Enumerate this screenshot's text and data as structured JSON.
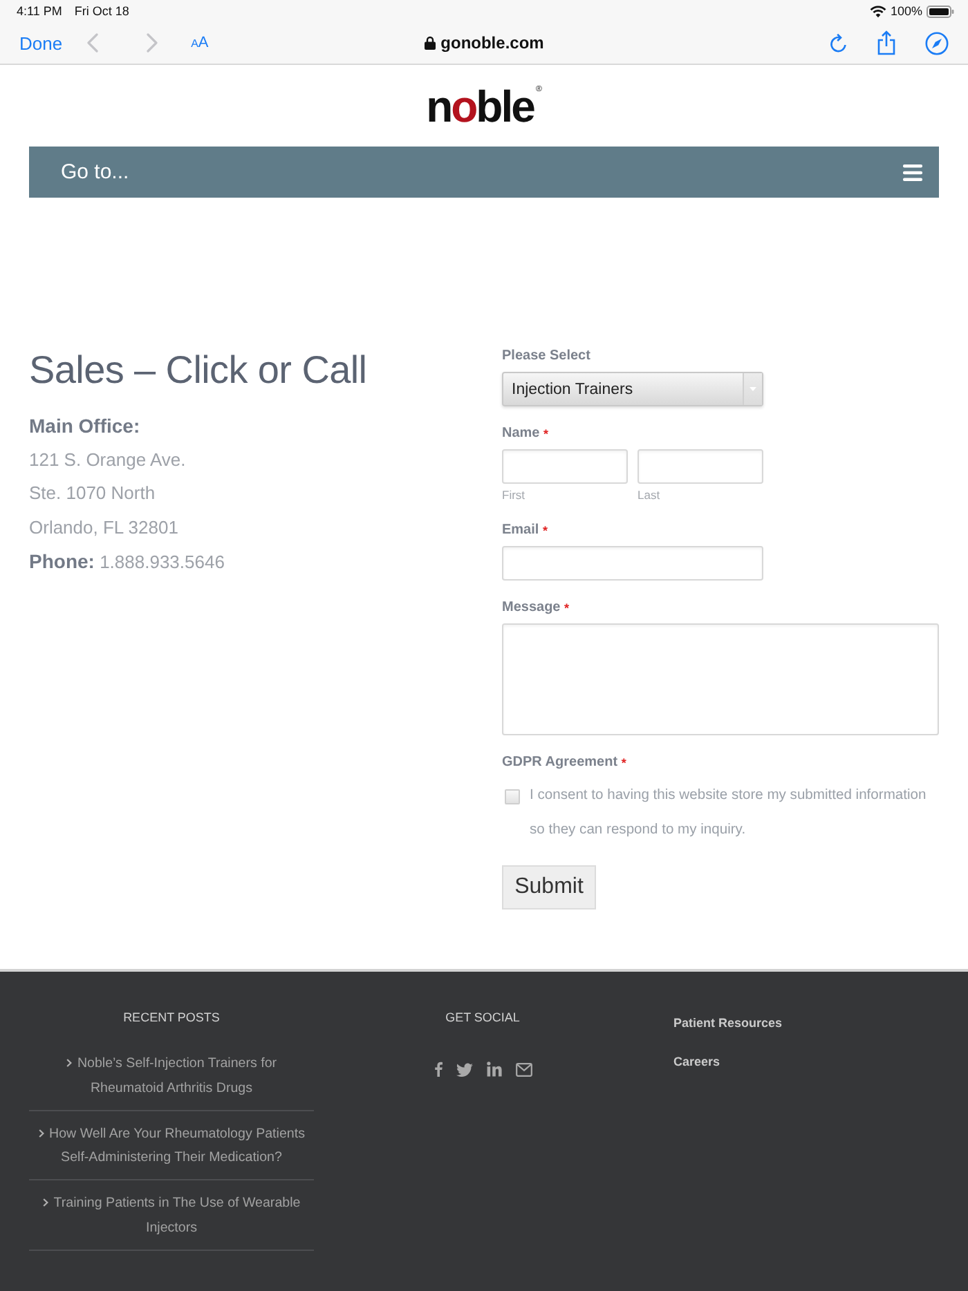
{
  "status_bar": {
    "time": "4:11 PM",
    "date": "Fri Oct 18",
    "battery": "100%"
  },
  "browser_bar": {
    "done": "Done",
    "back": {
      "disabled": true
    },
    "forward": {
      "disabled": true
    },
    "text_size": "AA",
    "url": "gonoble.com"
  },
  "logo": {
    "text": "noble",
    "registered": "®"
  },
  "nav": {
    "label": "Go to..."
  },
  "contact": {
    "title": "Sales – Click or Call",
    "lines": [
      {
        "kind": "heading",
        "text": "Main Office:"
      },
      {
        "kind": "plain",
        "text": "121 S. Orange Ave."
      },
      {
        "kind": "plain",
        "text": "Ste. 1070 North"
      },
      {
        "kind": "plain",
        "text": "Orlando, FL 32801"
      },
      {
        "kind": "plain",
        "text": "**Phone:** 1.888.933.5646"
      }
    ]
  },
  "form": {
    "required_mark": "*",
    "fields": [
      {
        "kind": "select",
        "label": "Please Select",
        "required": false,
        "value": "Injection Trainers"
      },
      {
        "kind": "name",
        "label": "Name",
        "required": true,
        "parts": [
          {
            "caption": "First"
          },
          {
            "caption": "Last"
          }
        ]
      },
      {
        "kind": "text",
        "label": "Email",
        "required": true
      },
      {
        "kind": "textarea",
        "label": "Message",
        "required": true
      },
      {
        "kind": "consent",
        "label": "GDPR Agreement",
        "required": true,
        "checked": false,
        "text": "I consent to having this website store my submitted information so they can respond to my inquiry."
      }
    ],
    "submit": "Submit"
  },
  "footer": {
    "recent_posts": {
      "title": "RECENT POSTS",
      "posts": [
        "Noble’s Self-Injection Trainers for Rheumatoid Arthritis Drugs",
        "How Well Are Your Rheumatology Patients Self-Administering Their Medication?",
        "Training Patients in The Use of Wearable Injectors"
      ]
    },
    "social": {
      "title": "GET SOCIAL"
    },
    "links": [
      "Patient Resources",
      "Careers"
    ]
  }
}
